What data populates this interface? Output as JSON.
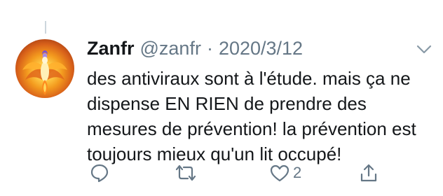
{
  "tweet": {
    "author": {
      "display_name": "Zanfr",
      "handle": "@zanfr"
    },
    "separator": "·",
    "date": "2020/3/12",
    "text_lines": [
      "des antiviraux sont à l'étude. mais ça ne",
      "dispense EN RIEN de prendre des",
      "mesures de prévention! la prévention est",
      "toujours mieux qu'un lit occupé!"
    ],
    "actions": {
      "reply_icon": "reply-icon",
      "retweet_icon": "retweet-icon",
      "like_icon": "heart-icon",
      "like_count": "2",
      "share_icon": "share-icon"
    },
    "more_icon": "chevron-down-icon"
  },
  "colors": {
    "text": "#14171a",
    "muted": "#657786",
    "thread_line": "#ccd6dd"
  }
}
